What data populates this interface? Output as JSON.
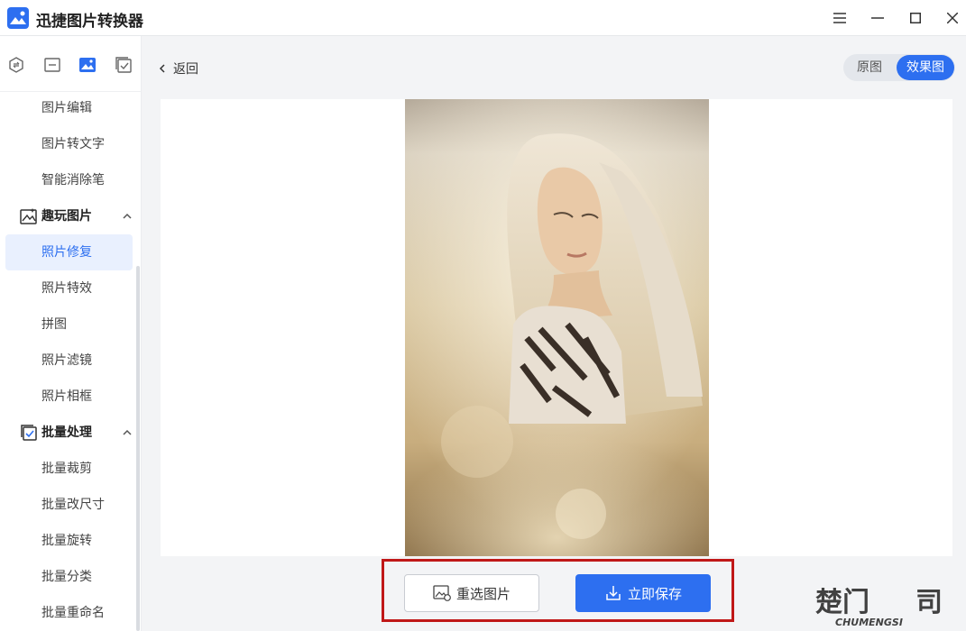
{
  "app": {
    "title": "迅捷图片转换器",
    "logo_icon": "picture-logo-icon"
  },
  "window_controls": [
    "menu-icon",
    "minimize-icon",
    "maximize-icon",
    "close-icon"
  ],
  "sidebar": {
    "top_icons": [
      "convert-icon",
      "compress-icon",
      "image-icon",
      "batch-check-icon"
    ],
    "items": [
      {
        "label": "图片编辑"
      },
      {
        "label": "图片转文字"
      },
      {
        "label": "智能消除笔"
      }
    ],
    "section_fun": {
      "label": "趣玩图片",
      "icon": "fun-image-icon"
    },
    "fun_items": [
      {
        "label": "照片修复",
        "active": true
      },
      {
        "label": "照片特效"
      },
      {
        "label": "拼图"
      },
      {
        "label": "照片滤镜"
      },
      {
        "label": "照片相框"
      }
    ],
    "section_batch": {
      "label": "批量处理",
      "icon": "batch-icon"
    },
    "batch_items": [
      {
        "label": "批量裁剪"
      },
      {
        "label": "批量改尺寸"
      },
      {
        "label": "批量旋转"
      },
      {
        "label": "批量分类"
      },
      {
        "label": "批量重命名"
      }
    ]
  },
  "main": {
    "back_label": "返回",
    "toggle": {
      "original": "原图",
      "effect": "效果图",
      "selected": "效果图"
    },
    "reselect_label": "重选图片",
    "save_label": "立即保存"
  },
  "watermark": {
    "main": "楚门",
    "sub": "CHUMENGSI"
  },
  "colors": {
    "accent": "#2d6ff0",
    "highlight": "#c01818"
  }
}
